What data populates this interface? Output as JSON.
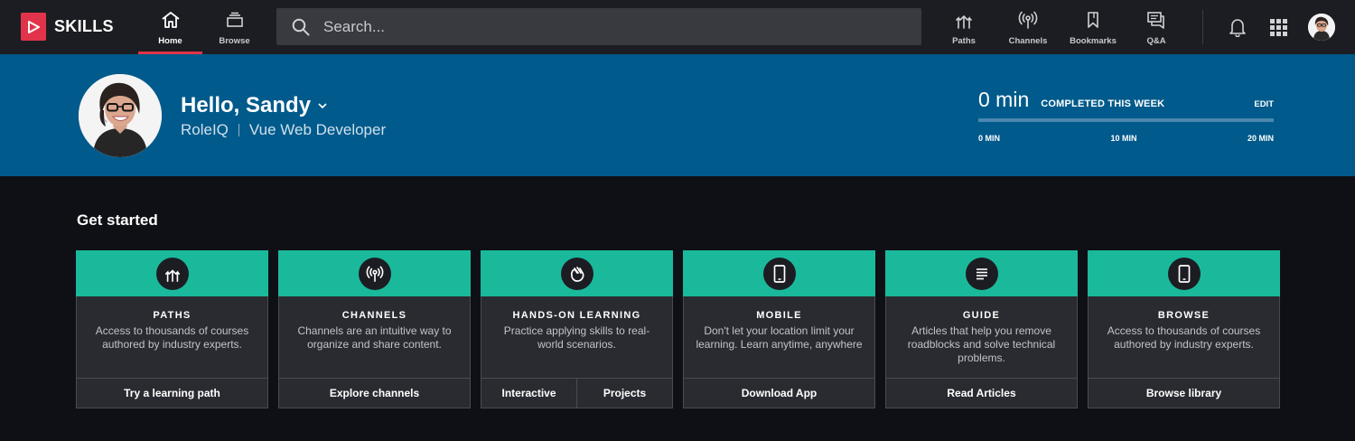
{
  "brand": {
    "name": "SKILLS",
    "accent": "#e1344a"
  },
  "nav": {
    "tabs": [
      {
        "label": "Home",
        "icon": "home-icon",
        "active": true
      },
      {
        "label": "Browse",
        "icon": "browse-icon",
        "active": false
      }
    ],
    "search_placeholder": "Search...",
    "right_items": [
      {
        "label": "Paths",
        "icon": "paths-icon"
      },
      {
        "label": "Channels",
        "icon": "channels-icon"
      },
      {
        "label": "Bookmarks",
        "icon": "bookmark-icon"
      },
      {
        "label": "Q&A",
        "icon": "qa-icon"
      }
    ]
  },
  "hero": {
    "greeting": "Hello, Sandy",
    "role_prefix": "RoleIQ",
    "role": "Vue Web Developer",
    "progress": {
      "value": "0 min",
      "label": "COMPLETED THIS WEEK",
      "edit": "EDIT",
      "fraction": 0,
      "ticks": [
        "0 MIN",
        "10 MIN",
        "20 MIN"
      ]
    },
    "background": "#005a8b"
  },
  "get_started": {
    "title": "Get started",
    "accent": "#1ab99c",
    "cards": [
      {
        "title": "PATHS",
        "icon": "paths-icon",
        "description": "Access to thousands of courses authored by industry experts.",
        "actions": [
          "Try a learning path"
        ]
      },
      {
        "title": "CHANNELS",
        "icon": "channels-icon",
        "description": "Channels are an intuitive way to organize and share content.",
        "actions": [
          "Explore channels"
        ]
      },
      {
        "title": "HANDS-ON LEARNING",
        "icon": "hands-on-icon",
        "description": "Practice applying skills to real-world scenarios.",
        "actions": [
          "Interactive",
          "Projects"
        ]
      },
      {
        "title": "MOBILE",
        "icon": "mobile-icon",
        "description": "Don't let your location limit your learning. Learn anytime, anywhere",
        "actions": [
          "Download App"
        ]
      },
      {
        "title": "GUIDE",
        "icon": "guide-icon",
        "description": "Articles that help you remove roadblocks and solve technical problems.",
        "actions": [
          "Read Articles"
        ]
      },
      {
        "title": "BROWSE",
        "icon": "mobile-icon",
        "description": "Access to thousands of courses authored by industry experts.",
        "actions": [
          "Browse library"
        ]
      }
    ]
  }
}
